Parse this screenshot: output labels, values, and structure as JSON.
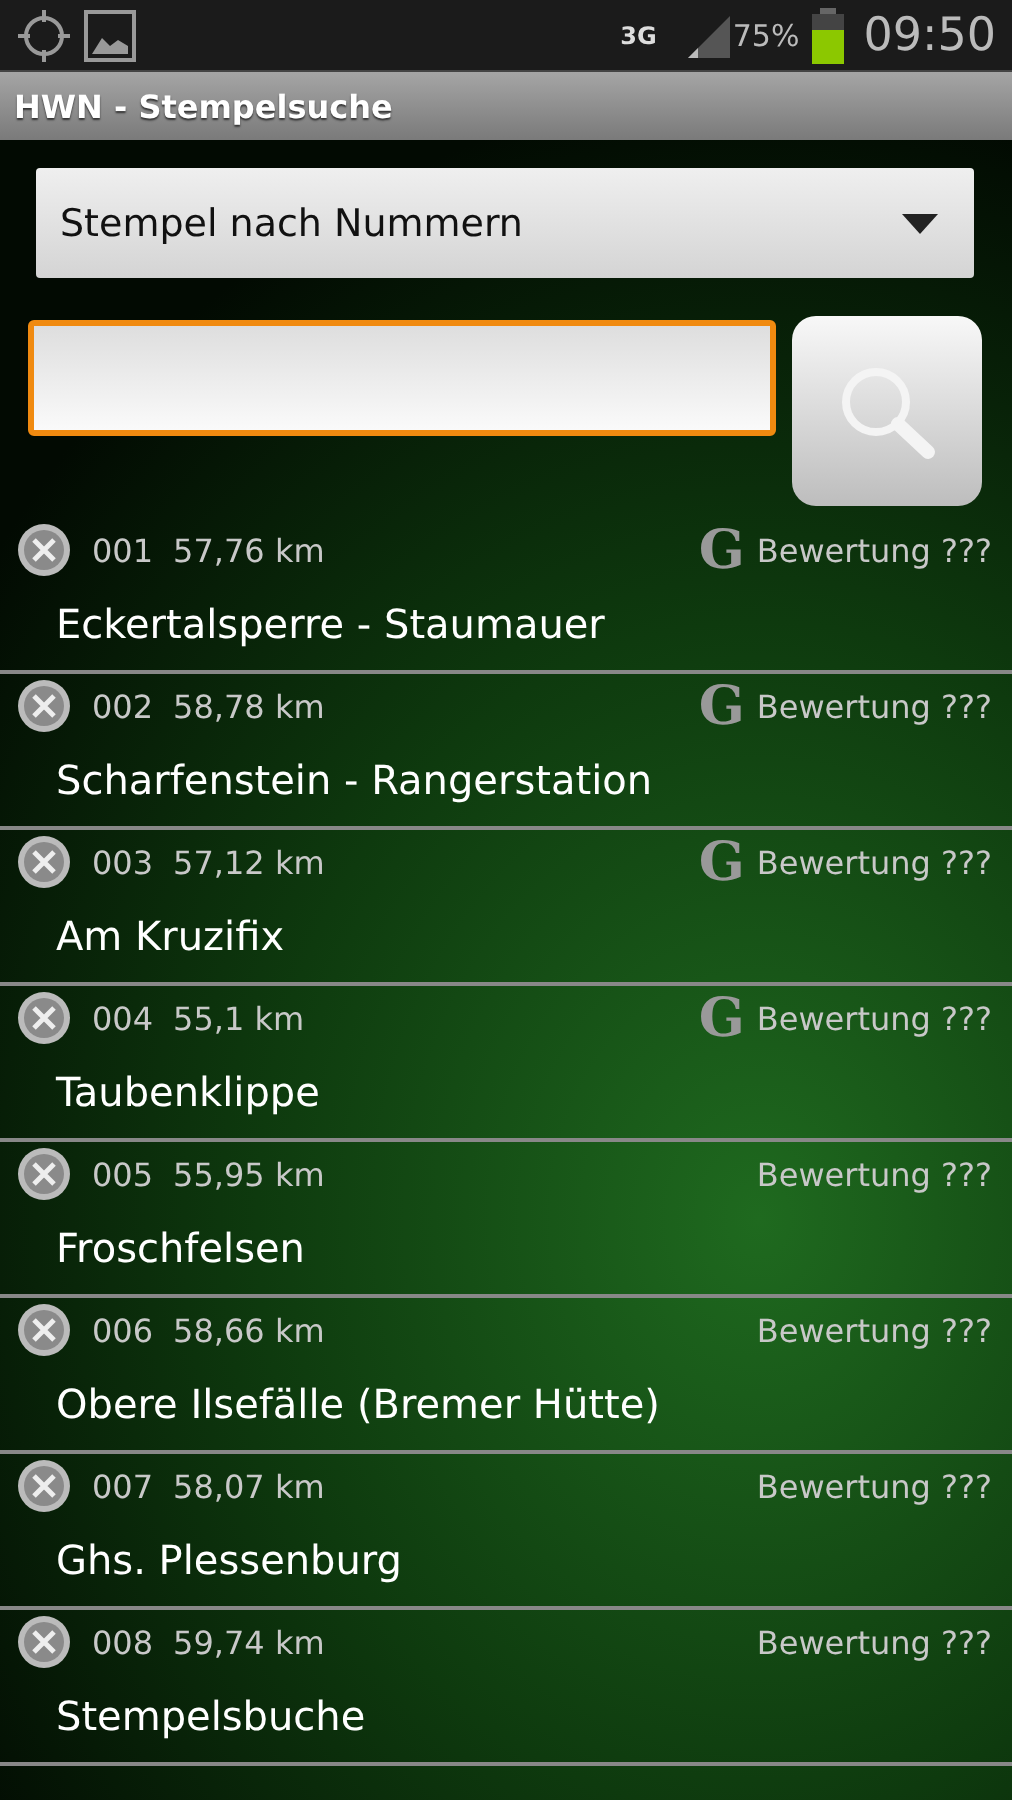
{
  "status_bar": {
    "network": "3G",
    "battery": "75%",
    "time": "09:50"
  },
  "title": "HWN - Stempelsuche",
  "dropdown": {
    "value": "Stempel nach Nummern"
  },
  "rows": [
    {
      "number": "001",
      "distance": "57,76 km",
      "mark": "G",
      "extra_icons": [],
      "rating": "Bewertung ???",
      "name": "Eckertalsperre - Staumauer"
    },
    {
      "number": "002",
      "distance": "58,78 km",
      "mark": "G",
      "extra_icons": [],
      "rating": "Bewertung ???",
      "name": "Scharfenstein - Rangerstation"
    },
    {
      "number": "003",
      "distance": "57,12 km",
      "mark": "G",
      "extra_icons": [],
      "rating": "Bewertung ???",
      "name": "Am Kruzifix"
    },
    {
      "number": "004",
      "distance": "55,1 km",
      "mark": "G",
      "extra_icons": [],
      "rating": "Bewertung ???",
      "name": "Taubenklippe"
    },
    {
      "number": "005",
      "distance": "55,95 km",
      "extra_icons": [],
      "rating": "Bewertung ???",
      "name": "Froschfelsen"
    },
    {
      "number": "006",
      "distance": "58,66 km",
      "extra_icons": [],
      "rating": "Bewertung ???",
      "name": "Obere Ilsefälle (Bremer Hütte)"
    },
    {
      "number": "007",
      "distance": "58,07 km",
      "extra_icons": [],
      "rating": "Bewertung ???",
      "name": "Ghs. Plessenburg"
    },
    {
      "number": "008",
      "distance": "59,74 km",
      "extra_icons": [],
      "rating": "Bewertung ???",
      "name": "Stempelsbuche"
    }
  ]
}
